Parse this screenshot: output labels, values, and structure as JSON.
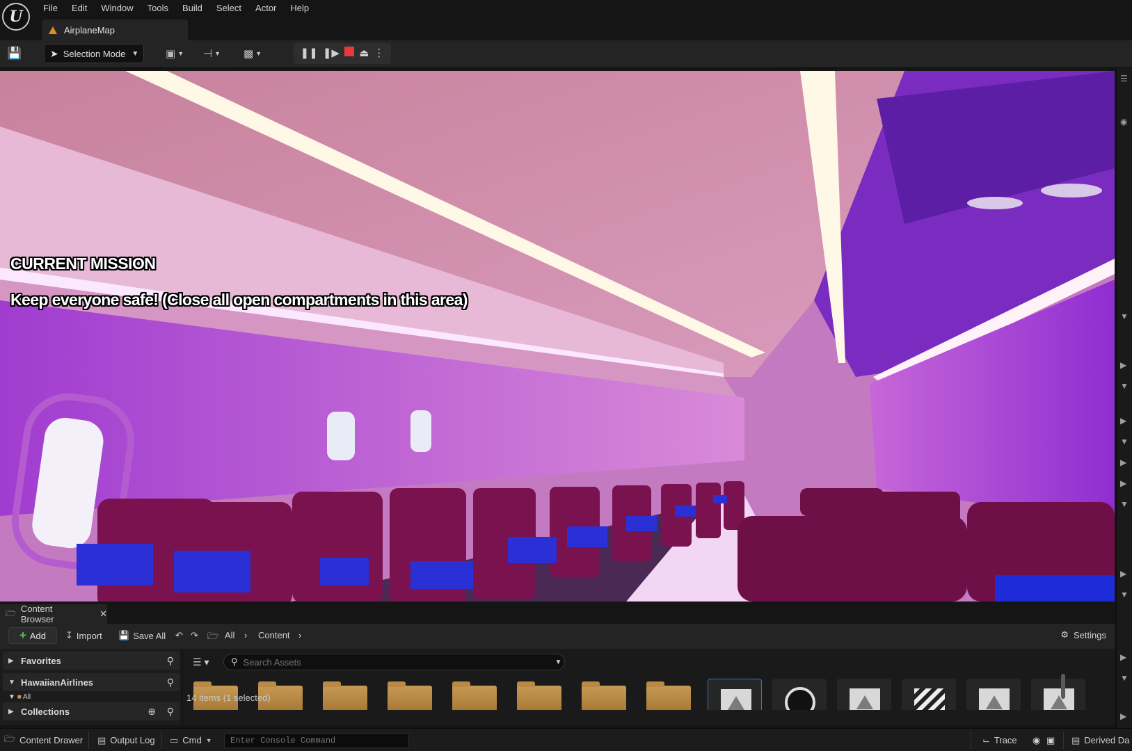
{
  "menu": {
    "items": [
      "File",
      "Edit",
      "Window",
      "Tools",
      "Build",
      "Select",
      "Actor",
      "Help"
    ]
  },
  "level_tab": {
    "label": "AirplaneMap"
  },
  "toolbar": {
    "selection_mode": "Selection Mode"
  },
  "viewport": {
    "mission_title": "CURRENT MISSION",
    "mission_text": "Keep everyone safe! (Close all open compartments in this area)"
  },
  "content_browser": {
    "tab_title": "Content Browser",
    "add_label": "Add",
    "import_label": "Import",
    "save_all_label": "Save All",
    "breadcrumb": [
      "All",
      "Content"
    ],
    "settings_label": "Settings",
    "search_placeholder": "Search Assets",
    "sections": {
      "favorites": "Favorites",
      "project": "HawaiianAirlines",
      "all_folder": "All",
      "collections": "Collections"
    },
    "items_count": "14 items (1 selected)",
    "tiles": [
      "folder",
      "folder",
      "folder",
      "folder",
      "folder",
      "folder",
      "folder",
      "folder",
      "texture",
      "sphere",
      "texture",
      "level-sequence",
      "texture",
      "texture"
    ]
  },
  "statusbar": {
    "content_drawer": "Content Drawer",
    "output_log": "Output Log",
    "cmd": "Cmd",
    "console_placeholder": "Enter Console Command",
    "trace": "Trace",
    "derived_data": "Derived Da"
  },
  "colors": {
    "accent_add": "#58c14b",
    "stop_button": "#e8393a",
    "selection_border": "#2f73d6",
    "map_icon": "#e88a1a"
  }
}
